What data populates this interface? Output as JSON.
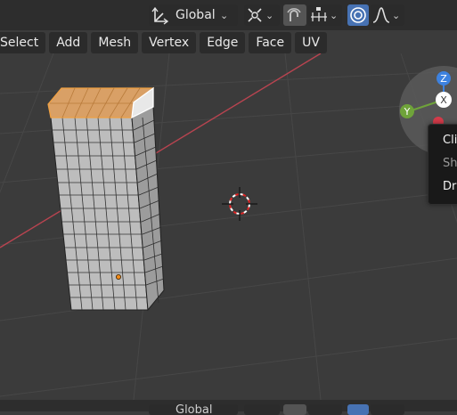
{
  "header": {
    "orientation_label": "Global",
    "orientation_icon": "transform-orientation-icon",
    "pivot_icon": "pivot-point-icon",
    "snap_icon": "snap-magnet-icon",
    "snap_target_icon": "snap-increment-icon",
    "proportional_icon": "proportional-editing-icon",
    "falloff_icon": "falloff-curve-icon"
  },
  "menu": {
    "items": [
      "Select",
      "Add",
      "Mesh",
      "Vertex",
      "Edge",
      "Face",
      "UV"
    ]
  },
  "gizmo": {
    "z_label": "Z",
    "y_label": "Y",
    "x_label": "X"
  },
  "tooltip": {
    "lines": [
      "Clic",
      "Sh",
      "Dra"
    ]
  },
  "bottom": {
    "orientation_label": "Global"
  },
  "colors": {
    "background": "#3b3b3b",
    "grid": "#454545",
    "header": "#2d2d2d",
    "button": "#2b2b2b",
    "accent_blue": "#4772b3",
    "x_axis_line": "#b84450",
    "face_selected": "#d9a066",
    "mesh_face": "#bdbdbd",
    "gizmo_z": "#3d82e0",
    "gizmo_y": "#6fa33a",
    "gizmo_x": "#d43b4a"
  }
}
